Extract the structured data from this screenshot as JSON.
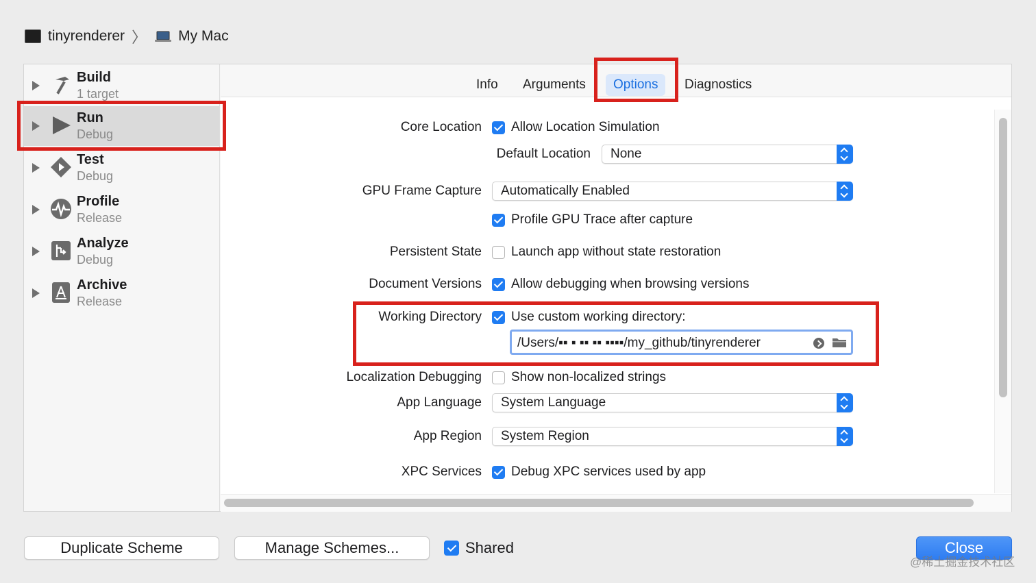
{
  "breadcrumb": {
    "scheme": "tinyrenderer",
    "destination": "My Mac"
  },
  "sidebar": {
    "items": [
      {
        "title": "Build",
        "subtitle": "1 target",
        "icon": "hammer-icon"
      },
      {
        "title": "Run",
        "subtitle": "Debug",
        "icon": "play-icon"
      },
      {
        "title": "Test",
        "subtitle": "Debug",
        "icon": "test-diamond-icon"
      },
      {
        "title": "Profile",
        "subtitle": "Release",
        "icon": "profile-waveform-icon"
      },
      {
        "title": "Analyze",
        "subtitle": "Debug",
        "icon": "analyze-icon"
      },
      {
        "title": "Archive",
        "subtitle": "Release",
        "icon": "archive-app-icon"
      }
    ],
    "selected": "Run"
  },
  "tabs": {
    "info": "Info",
    "arguments": "Arguments",
    "options": "Options",
    "diagnostics": "Diagnostics",
    "active": "Options"
  },
  "options": {
    "core_location": {
      "label": "Core Location",
      "checkbox": "Allow Location Simulation",
      "checked": true
    },
    "default_location": {
      "label": "Default Location",
      "value": "None"
    },
    "gpu_frame_capture": {
      "label": "GPU Frame Capture",
      "value": "Automatically Enabled"
    },
    "profile_gpu": {
      "checkbox": "Profile GPU Trace after capture",
      "checked": true
    },
    "persistent_state": {
      "label": "Persistent State",
      "checkbox": "Launch app without state restoration",
      "checked": false
    },
    "document_versions": {
      "label": "Document Versions",
      "checkbox": "Allow debugging when browsing versions",
      "checked": true
    },
    "working_directory": {
      "label": "Working Directory",
      "checkbox": "Use custom working directory:",
      "checked": true,
      "path": "/Users/▪▪ ▪ ▪▪ ▪▪    ▪▪▪▪/my_github/tinyrenderer"
    },
    "localization_debugging": {
      "label": "Localization Debugging",
      "checkbox": "Show non-localized strings",
      "checked": false
    },
    "app_language": {
      "label": "App Language",
      "value": "System Language"
    },
    "app_region": {
      "label": "App Region",
      "value": "System Region"
    },
    "xpc_services": {
      "label": "XPC Services",
      "checkbox": "Debug XPC services used by app",
      "checked": true
    }
  },
  "footer": {
    "duplicate": "Duplicate Scheme",
    "manage": "Manage Schemes...",
    "shared": "Shared",
    "shared_checked": true,
    "close": "Close"
  },
  "watermark": "@稀土掘金技术社区",
  "colors": {
    "accent": "#1f7cf2",
    "highlight": "#d8211c",
    "tab_active_bg": "#dbe8fb"
  }
}
